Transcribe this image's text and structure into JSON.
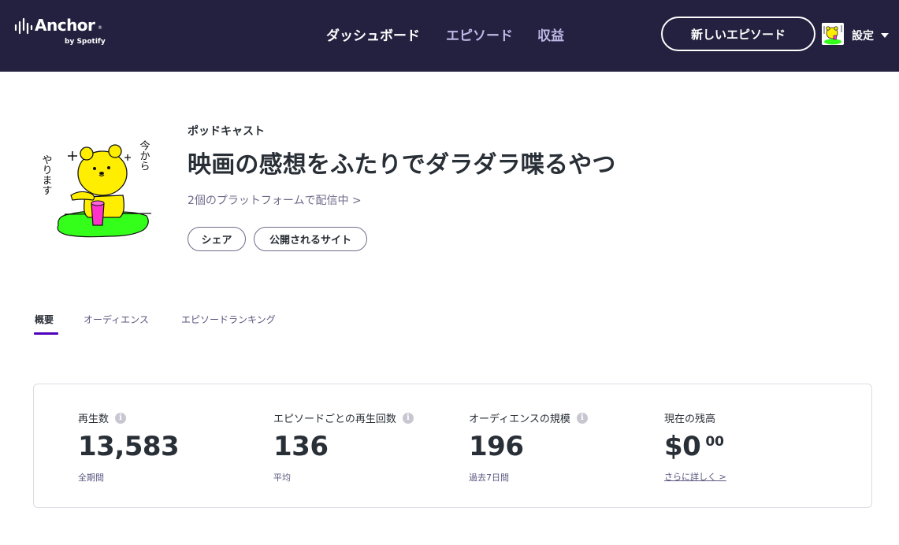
{
  "brand": {
    "name": "Anchor",
    "registered": "®",
    "sub": "by Spotify"
  },
  "nav": {
    "items": [
      {
        "label": "ダッシュボード",
        "active": true
      },
      {
        "label": "エピソード",
        "active": false
      },
      {
        "label": "収益",
        "active": false
      }
    ],
    "new_episode_label": "新しいエピソード",
    "settings_label": "設定"
  },
  "podcast": {
    "kicker": "ポッドキャスト",
    "title": "映画の感想をふたりでダラダラ喋るやつ",
    "platforms_text": "2個のプラットフォームで配信中 >",
    "share_label": "シェア",
    "public_site_label": "公開されるサイト",
    "cover_text": {
      "line1": "今から",
      "line2": "やります"
    }
  },
  "tabs": [
    {
      "label": "概要",
      "active": true
    },
    {
      "label": "オーディエンス",
      "active": false
    },
    {
      "label": "エピソードランキング",
      "active": false
    }
  ],
  "stats": [
    {
      "label": "再生数",
      "value": "13,583",
      "sub": "全期間",
      "info": true
    },
    {
      "label": "エピソードごとの再生回数",
      "value": "136",
      "sub": "平均",
      "info": true
    },
    {
      "label": "オーディエンスの規模",
      "value": "196",
      "sub": "過去7日間",
      "info": true
    },
    {
      "label": "現在の残高",
      "value": "$0",
      "cents": "00",
      "link": "さらに詳しく >",
      "info": false
    }
  ],
  "icons": {
    "info": "i",
    "logo": "anchor-waves-icon",
    "caret": "chevron-down-icon"
  },
  "colors": {
    "nav_bg": "#24203f",
    "tab_accent": "#5000b9",
    "nav_muted": "#bdb8e6",
    "cover_bear": "#ffee00",
    "cover_grass": "#33ff1a",
    "cover_cup": "#ff33cc"
  }
}
